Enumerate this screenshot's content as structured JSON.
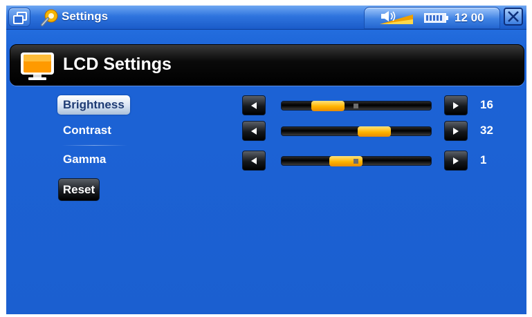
{
  "topbar": {
    "app_title": "Settings",
    "clock": "12 00",
    "icons": {
      "window": "window-switch-icon",
      "app": "settings-gear-icon",
      "volume": "volume-icon",
      "battery": "battery-icon",
      "close": "close-icon"
    }
  },
  "header": {
    "title": "LCD Settings",
    "icon": "monitor-icon"
  },
  "menu": {
    "items": [
      {
        "label": "Brightness",
        "selected": true
      },
      {
        "label": "Contrast",
        "selected": false
      },
      {
        "label": "Gamma",
        "selected": false
      }
    ],
    "reset_label": "Reset"
  },
  "sliders": [
    {
      "name": "brightness",
      "value": "16",
      "level": 0.31
    },
    {
      "name": "contrast",
      "value": "32",
      "level": 0.62
    },
    {
      "name": "gamma",
      "value": "1",
      "level": 0.43
    }
  ],
  "colors": {
    "background": "#1f66d8",
    "accent": "#ffb400",
    "header": "#000000"
  }
}
